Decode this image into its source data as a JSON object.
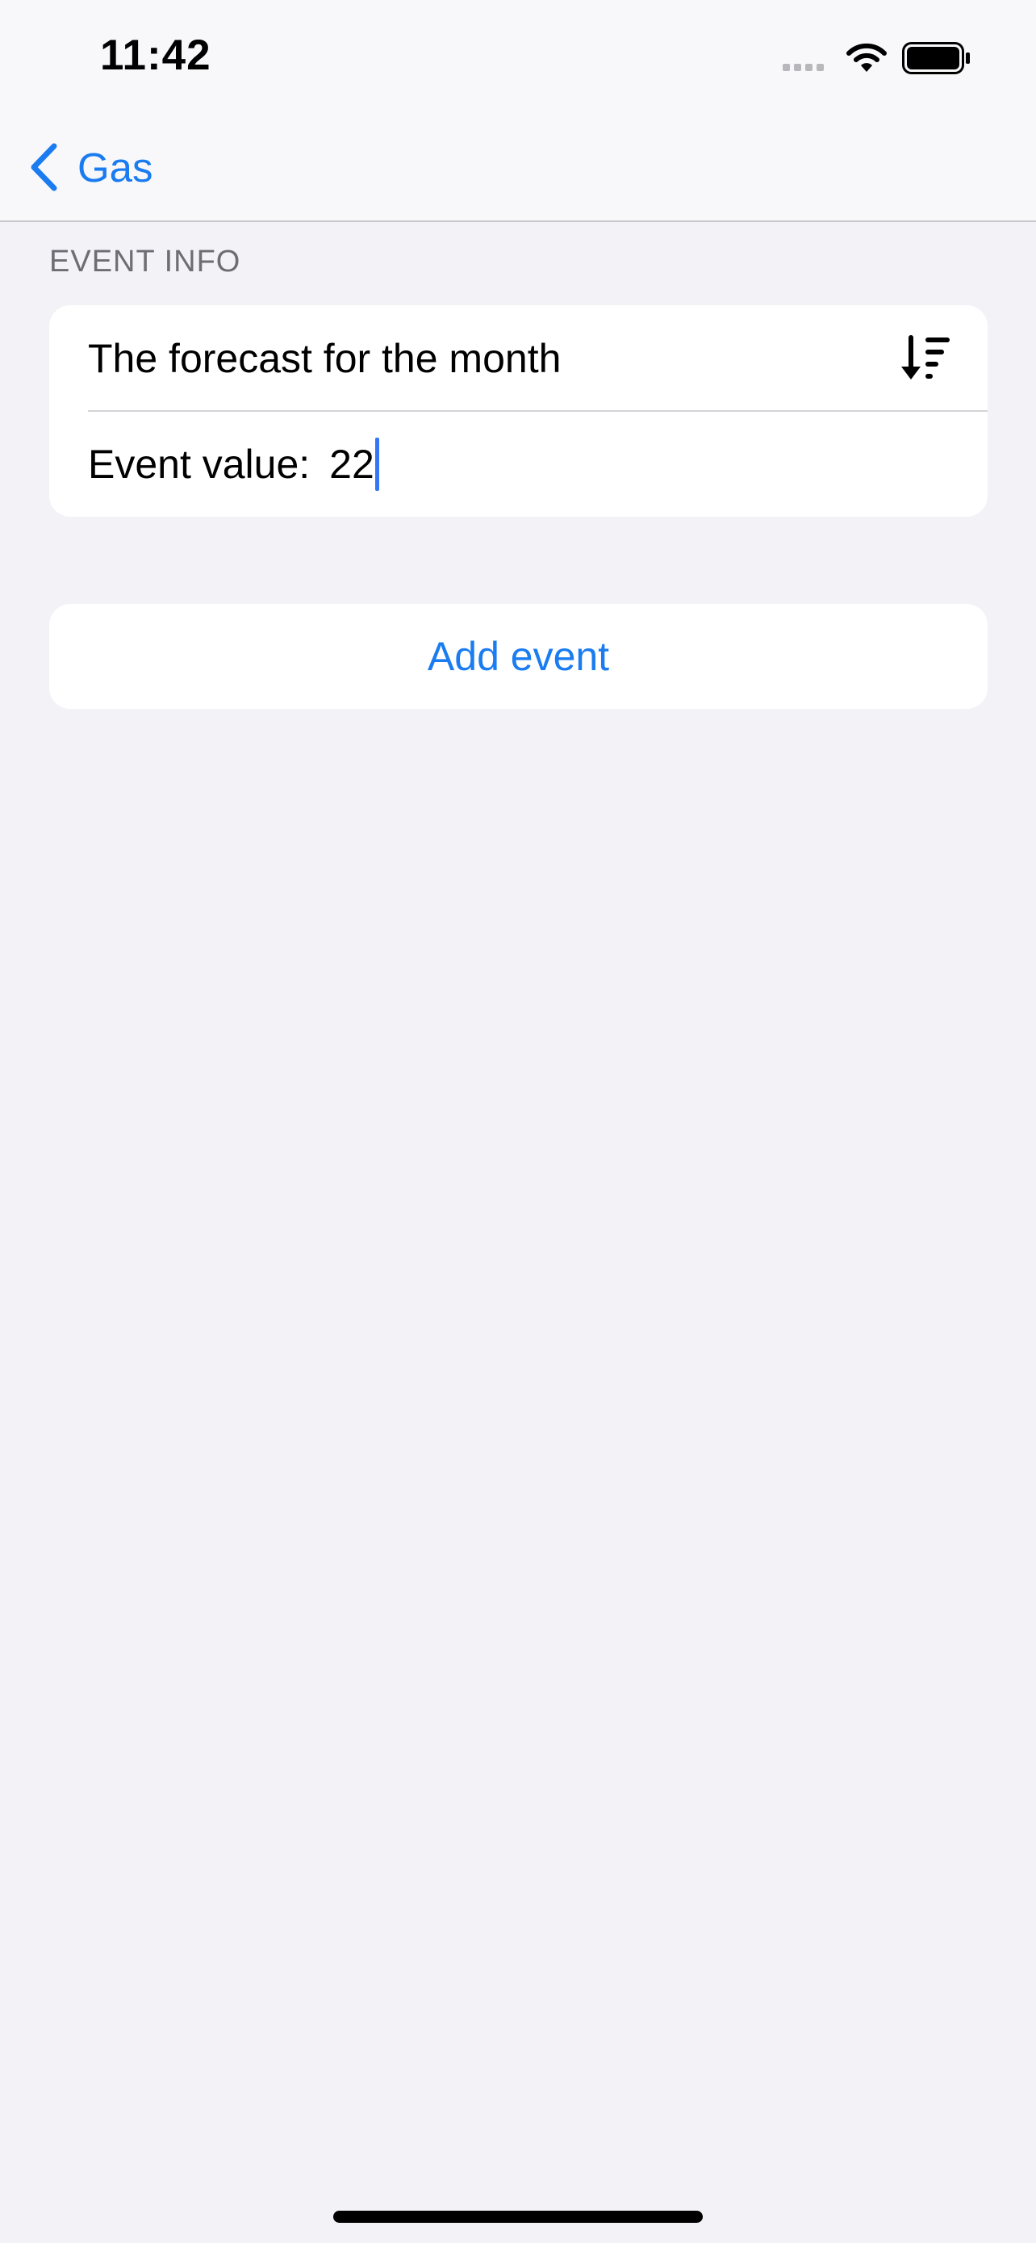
{
  "status_bar": {
    "time": "11:42",
    "icons": [
      "cellular-signal-icon",
      "wifi-icon",
      "battery-icon"
    ]
  },
  "nav": {
    "back_label": "Gas",
    "back_icon": "chevron-left-icon"
  },
  "section": {
    "header": "EVENT INFO"
  },
  "event": {
    "title": "The forecast for the month",
    "sort_icon": "sort-descending-icon",
    "value_label": "Event value:",
    "value": "22"
  },
  "actions": {
    "add_event_label": "Add event"
  },
  "colors": {
    "accent": "#1a7cf0",
    "background": "#f2f2f7",
    "card": "#ffffff",
    "nav_background": "#f8f8fa",
    "secondary_text": "#6d6d72",
    "caret": "#3478f6"
  }
}
